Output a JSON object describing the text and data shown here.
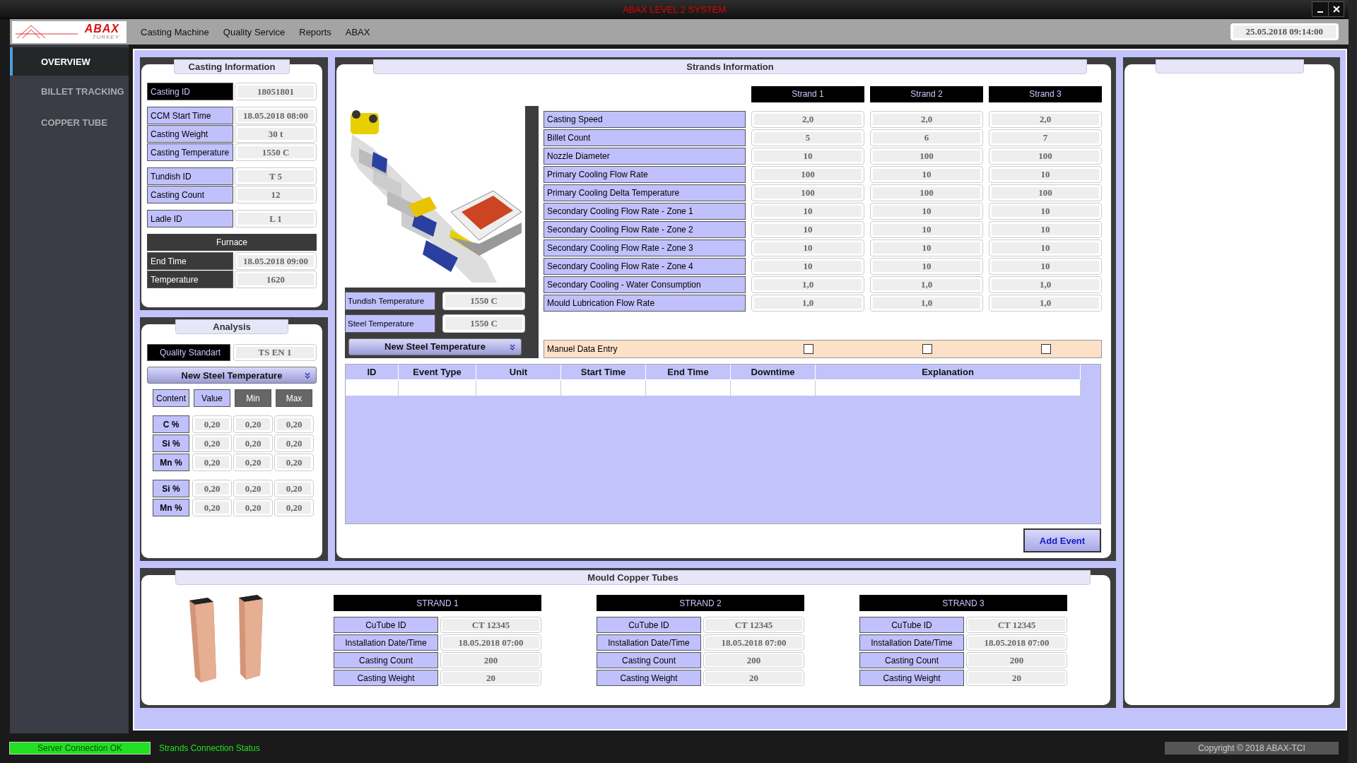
{
  "window": {
    "title": "ABAX LEVEL 2 SYSTEM"
  },
  "logo": {
    "name": "ABAX",
    "subtitle": "TURKEY"
  },
  "menu": [
    "Casting Machine",
    "Quality Service",
    "Reports",
    "ABAX"
  ],
  "datetime": "25.05.2018 09:14:00",
  "sidebar": {
    "items": [
      {
        "label": "OVERVIEW",
        "selected": true
      },
      {
        "label": "BILLET TRACKING",
        "selected": false
      },
      {
        "label": "COPPER TUBE",
        "selected": false
      }
    ]
  },
  "casting_information": {
    "title": "Casting Information",
    "groups": [
      {
        "fields": [
          {
            "label": "Casting ID",
            "value": "18051801",
            "kind": "black"
          }
        ]
      },
      {
        "fields": [
          {
            "label": "CCM Start Time",
            "value": "18.05.2018 08:00",
            "kind": "light"
          },
          {
            "label": "Casting Weight",
            "value": "30 t",
            "kind": "light"
          },
          {
            "label": "Casting Temperature",
            "value": "1550 C",
            "kind": "light"
          }
        ]
      },
      {
        "fields": [
          {
            "label": "Tundish ID",
            "value": "T 5",
            "kind": "light"
          },
          {
            "label": "Casting Count",
            "value": "12",
            "kind": "light"
          }
        ]
      },
      {
        "fields": [
          {
            "label": "Ladle ID",
            "value": "L 1",
            "kind": "light"
          }
        ]
      },
      {
        "header": "Furnace",
        "fields": [
          {
            "label": "End Time",
            "value": "18.05.2018 09:00",
            "kind": "dark"
          },
          {
            "label": "Temperature",
            "value": "1620",
            "kind": "dark"
          }
        ]
      }
    ]
  },
  "analysis": {
    "title": "Analysis",
    "quality_standard": {
      "label": "Quality Standart",
      "value": "TS EN 1"
    },
    "dropdown": "New Steel Temperature",
    "columns": [
      {
        "label": "Content",
        "kind": "light"
      },
      {
        "label": "Value",
        "kind": "light"
      },
      {
        "label": "Min",
        "kind": "dark"
      },
      {
        "label": "Max",
        "kind": "dark"
      }
    ],
    "groups": [
      [
        {
          "content": "C %",
          "value": "0,20",
          "min": "0,20",
          "max": "0,20"
        },
        {
          "content": "Si %",
          "value": "0,20",
          "min": "0,20",
          "max": "0,20"
        },
        {
          "content": "Mn %",
          "value": "0,20",
          "min": "0,20",
          "max": "0,20"
        }
      ],
      [
        {
          "content": "Si %",
          "value": "0,20",
          "min": "0,20",
          "max": "0,20"
        },
        {
          "content": "Mn %",
          "value": "0,20",
          "min": "0,20",
          "max": "0,20"
        }
      ]
    ]
  },
  "strands_information": {
    "title": "Strands Information",
    "columns": [
      "Strand 1",
      "Strand 2",
      "Strand 3"
    ],
    "rows": [
      {
        "label": "Casting Speed",
        "values": [
          "2,0",
          "2,0",
          "2,0"
        ]
      },
      {
        "label": "Billet Count",
        "values": [
          "5",
          "6",
          "7"
        ]
      },
      {
        "label": "Nozzle Diameter",
        "values": [
          "10",
          "100",
          "100"
        ]
      },
      {
        "label": "Primary Cooling Flow Rate",
        "values": [
          "100",
          "10",
          "10"
        ]
      },
      {
        "label": "Primary Cooling Delta Temperature",
        "values": [
          "100",
          "100",
          "100"
        ]
      },
      {
        "label": "Secondary Cooling Flow Rate - Zone 1",
        "values": [
          "10",
          "10",
          "10"
        ]
      },
      {
        "label": "Secondary Cooling Flow Rate - Zone 2",
        "values": [
          "10",
          "10",
          "10"
        ]
      },
      {
        "label": "Secondary Cooling Flow Rate - Zone 3",
        "values": [
          "10",
          "10",
          "10"
        ]
      },
      {
        "label": "Secondary Cooling Flow Rate - Zone 4",
        "values": [
          "10",
          "10",
          "10"
        ]
      },
      {
        "label": "Secondary Cooling - Water Consumption",
        "values": [
          "1,0",
          "1,0",
          "1,0"
        ]
      },
      {
        "label": "Mould Lubrication Flow Rate",
        "values": [
          "1,0",
          "1,0",
          "1,0"
        ]
      }
    ],
    "side_fields": [
      {
        "label": "Tundish Temperature",
        "value": "1550 C"
      },
      {
        "label": "Steel Temperature",
        "value": "1550 C"
      }
    ],
    "dropdown": "New Steel Temperature",
    "manual_entry": {
      "label": "Manuel Data Entry",
      "checks": [
        {
          "checked": false
        },
        {
          "checked": false
        },
        {
          "checked": false
        }
      ]
    },
    "events": {
      "columns": [
        "ID",
        "Event Type",
        "Unit",
        "Start Time",
        "End Time",
        "Downtime",
        "Explanation"
      ]
    },
    "add_button": "Add Event"
  },
  "mould_copper_tubes": {
    "title": "Mould Copper Tubes",
    "strands": [
      {
        "title": "STRAND 1",
        "fields": [
          {
            "label": "CuTube ID",
            "value": "CT 12345"
          },
          {
            "label": "Installation Date/Time",
            "value": "18.05.2018 07:00"
          },
          {
            "label": "Casting Count",
            "value": "200"
          },
          {
            "label": "Casting Weight",
            "value": "20"
          }
        ]
      },
      {
        "title": "STRAND 2",
        "fields": [
          {
            "label": "CuTube ID",
            "value": "CT 12345"
          },
          {
            "label": "Installation Date/Time",
            "value": "18.05.2018 07:00"
          },
          {
            "label": "Casting Count",
            "value": "200"
          },
          {
            "label": "Casting Weight",
            "value": "20"
          }
        ]
      },
      {
        "title": "STRAND 3",
        "fields": [
          {
            "label": "CuTube ID",
            "value": "CT 12345"
          },
          {
            "label": "Installation Date/Time",
            "value": "18.05.2018 07:00"
          },
          {
            "label": "Casting Count",
            "value": "200"
          },
          {
            "label": "Casting Weight",
            "value": "20"
          }
        ]
      }
    ]
  },
  "status_bar": {
    "server": {
      "label": "Server Connection OK",
      "connected": true
    },
    "strands": "Strands Connection Status",
    "copyright": "Copyright © 2018   ABAX-TCI"
  }
}
